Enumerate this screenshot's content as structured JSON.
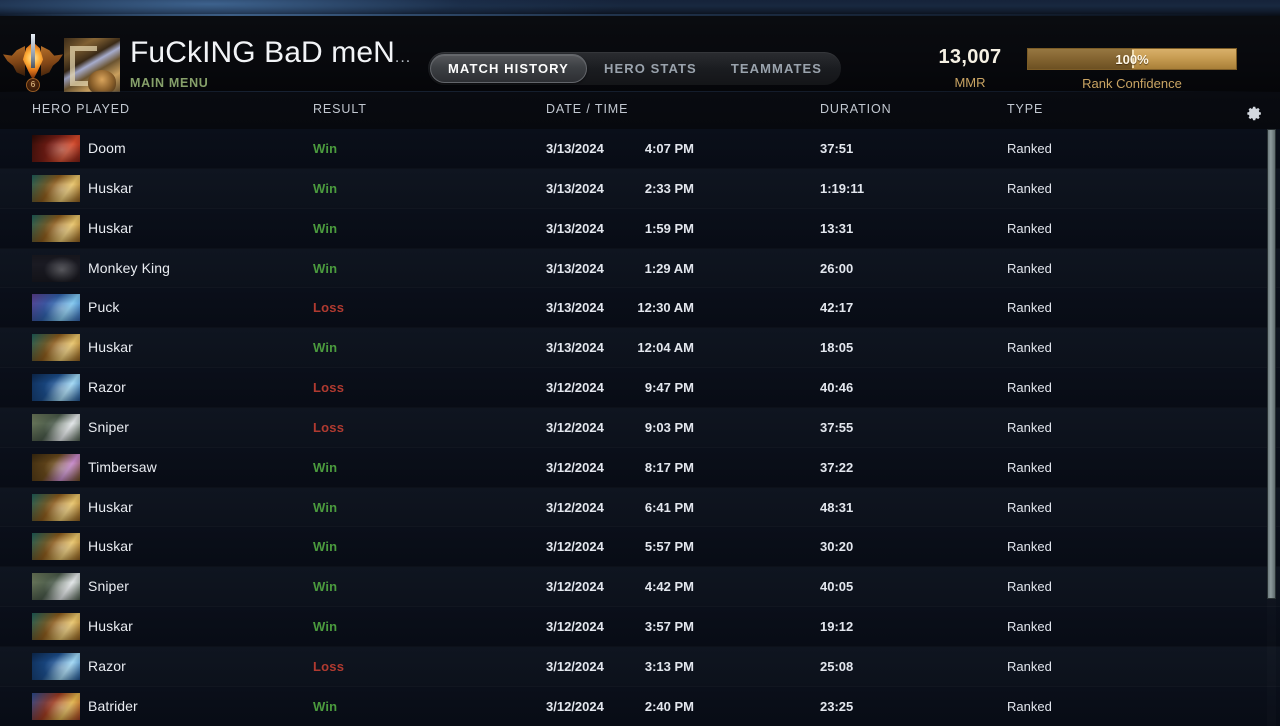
{
  "header": {
    "player_name": "FuCkING BaD meN",
    "player_name_ellipsis": "...",
    "submenu": "MAIN MENU",
    "medal_pip": "6",
    "tabs": [
      {
        "label": "MATCH HISTORY",
        "active": true
      },
      {
        "label": "HERO STATS",
        "active": false
      },
      {
        "label": "TEAMMATES",
        "active": false
      }
    ],
    "mmr_value": "13,007",
    "mmr_label": "MMR",
    "rank_confidence_pct": "100%",
    "rank_confidence_label": "Rank Confidence",
    "rank_confidence_fill": 100,
    "settings_icon": "gear-icon"
  },
  "colors": {
    "win": "#4b9b3e",
    "loss": "#b03a30",
    "gold": "#c9a463",
    "submenu_green": "#86a06a",
    "row_odd": "#0a0f1a",
    "row_even": "#0f1520"
  },
  "table": {
    "columns": [
      "HERO PLAYED",
      "RESULT",
      "DATE / TIME",
      "DURATION",
      "TYPE"
    ],
    "rows": [
      {
        "hero": "Doom",
        "result": "Win",
        "date": "3/13/2024",
        "time": "4:07 PM",
        "duration": "37:51",
        "type": "Ranked",
        "c1": "#7d1f16",
        "c2": "#d4492a",
        "c3": "#2a0a06"
      },
      {
        "hero": "Huskar",
        "result": "Win",
        "date": "3/13/2024",
        "time": "2:33 PM",
        "duration": "1:19:11",
        "type": "Ranked",
        "c1": "#8a5a1c",
        "c2": "#e8c46a",
        "c3": "#1d5f5a"
      },
      {
        "hero": "Huskar",
        "result": "Win",
        "date": "3/13/2024",
        "time": "1:59 PM",
        "duration": "13:31",
        "type": "Ranked",
        "c1": "#8a5a1c",
        "c2": "#e8c46a",
        "c3": "#1d5f5a"
      },
      {
        "hero": "Monkey King",
        "result": "Win",
        "date": "3/13/2024",
        "time": "1:29 AM",
        "duration": "26:00",
        "type": "Ranked",
        "c1": "#3f6b2a",
        "c2": "#d8a martian",
        "c3": "#2c4a1c"
      },
      {
        "hero": "Puck",
        "result": "Loss",
        "date": "3/13/2024",
        "time": "12:30 AM",
        "duration": "42:17",
        "type": "Ranked",
        "c1": "#2f5fa8",
        "c2": "#7ec6ef",
        "c3": "#5a3f8e"
      },
      {
        "hero": "Huskar",
        "result": "Win",
        "date": "3/13/2024",
        "time": "12:04 AM",
        "duration": "18:05",
        "type": "Ranked",
        "c1": "#8a5a1c",
        "c2": "#e8c46a",
        "c3": "#1d5f5a"
      },
      {
        "hero": "Razor",
        "result": "Loss",
        "date": "3/12/2024",
        "time": "9:47 PM",
        "duration": "40:46",
        "type": "Ranked",
        "c1": "#1c4f8e",
        "c2": "#9fd8f5",
        "c3": "#0d2a52"
      },
      {
        "hero": "Sniper",
        "result": "Loss",
        "date": "3/12/2024",
        "time": "9:03 PM",
        "duration": "37:55",
        "type": "Ranked",
        "c1": "#4a5a4a",
        "c2": "#e2e6e8",
        "c3": "#6d7a5c"
      },
      {
        "hero": "Timbersaw",
        "result": "Win",
        "date": "3/12/2024",
        "time": "8:17 PM",
        "duration": "37:22",
        "type": "Ranked",
        "c1": "#6a4a1c",
        "c2": "#c486c8",
        "c3": "#3a2a10"
      },
      {
        "hero": "Huskar",
        "result": "Win",
        "date": "3/12/2024",
        "time": "6:41 PM",
        "duration": "48:31",
        "type": "Ranked",
        "c1": "#8a5a1c",
        "c2": "#e8c46a",
        "c3": "#1d5f5a"
      },
      {
        "hero": "Huskar",
        "result": "Win",
        "date": "3/12/2024",
        "time": "5:57 PM",
        "duration": "30:20",
        "type": "Ranked",
        "c1": "#8a5a1c",
        "c2": "#e8c46a",
        "c3": "#1d5f5a"
      },
      {
        "hero": "Sniper",
        "result": "Win",
        "date": "3/12/2024",
        "time": "4:42 PM",
        "duration": "40:05",
        "type": "Ranked",
        "c1": "#4a5a4a",
        "c2": "#e2e6e8",
        "c3": "#6d7a5c"
      },
      {
        "hero": "Huskar",
        "result": "Win",
        "date": "3/12/2024",
        "time": "3:57 PM",
        "duration": "19:12",
        "type": "Ranked",
        "c1": "#8a5a1c",
        "c2": "#e8c46a",
        "c3": "#1d5f5a"
      },
      {
        "hero": "Razor",
        "result": "Loss",
        "date": "3/12/2024",
        "time": "3:13 PM",
        "duration": "25:08",
        "type": "Ranked",
        "c1": "#1c4f8e",
        "c2": "#9fd8f5",
        "c3": "#0d2a52"
      },
      {
        "hero": "Batrider",
        "result": "Win",
        "date": "3/12/2024",
        "time": "2:40 PM",
        "duration": "23:25",
        "type": "Ranked",
        "c1": "#9c3a20",
        "c2": "#e0b24a",
        "c3": "#2a4a8e"
      }
    ]
  }
}
